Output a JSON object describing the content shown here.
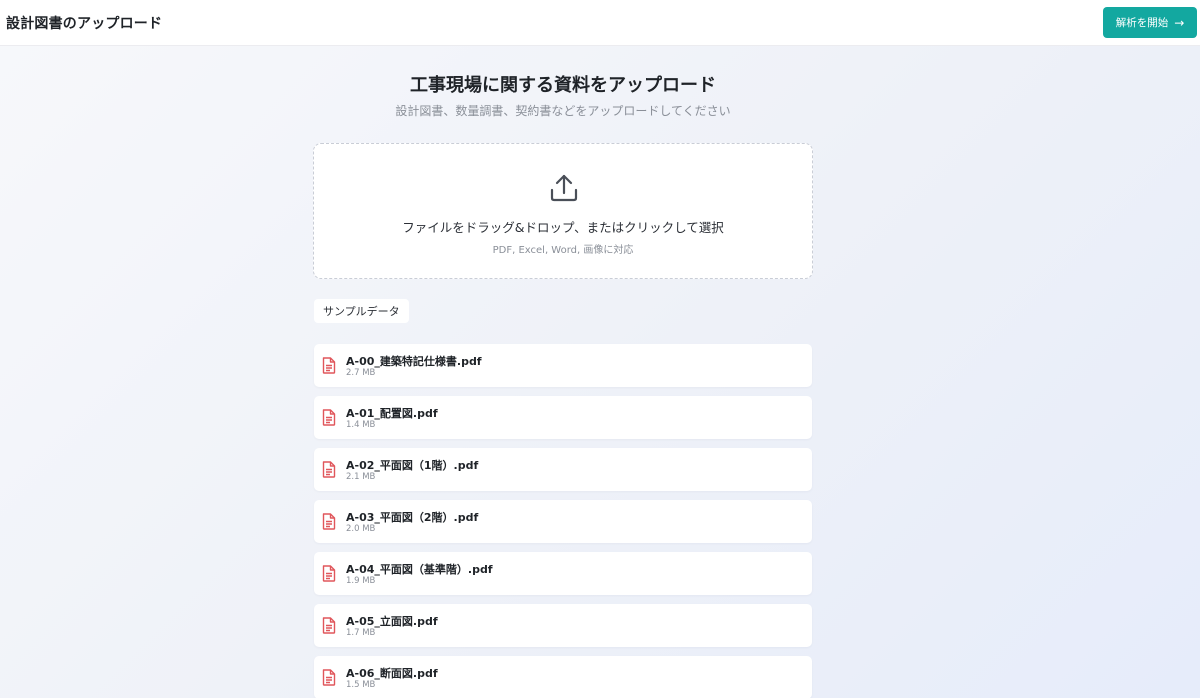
{
  "header": {
    "title": "設計図書のアップロード",
    "start_label": "解析を開始",
    "start_arrow": "→"
  },
  "main": {
    "title": "工事現場に関する資料をアップロード",
    "subtitle": "設計図書、数量調書、契約書などをアップロードしてください"
  },
  "dropzone": {
    "icon": "upload-icon",
    "text": "ファイルをドラッグ&ドロップ、またはクリックして選択",
    "formats": "PDF, Excel, Word, 画像に対応"
  },
  "sample": {
    "label": "サンプルデータ"
  },
  "files": [
    {
      "name": "A-00_建築特記仕様書.pdf",
      "size": "2.7 MB"
    },
    {
      "name": "A-01_配置図.pdf",
      "size": "1.4 MB"
    },
    {
      "name": "A-02_平面図（1階）.pdf",
      "size": "2.1 MB"
    },
    {
      "name": "A-03_平面図（2階）.pdf",
      "size": "2.0 MB"
    },
    {
      "name": "A-04_平面図（基準階）.pdf",
      "size": "1.9 MB"
    },
    {
      "name": "A-05_立面図.pdf",
      "size": "1.7 MB"
    },
    {
      "name": "A-06_断面図.pdf",
      "size": "1.5 MB"
    }
  ],
  "colors": {
    "accent": "#13a8a0",
    "pdf_icon": "#e0565b"
  }
}
